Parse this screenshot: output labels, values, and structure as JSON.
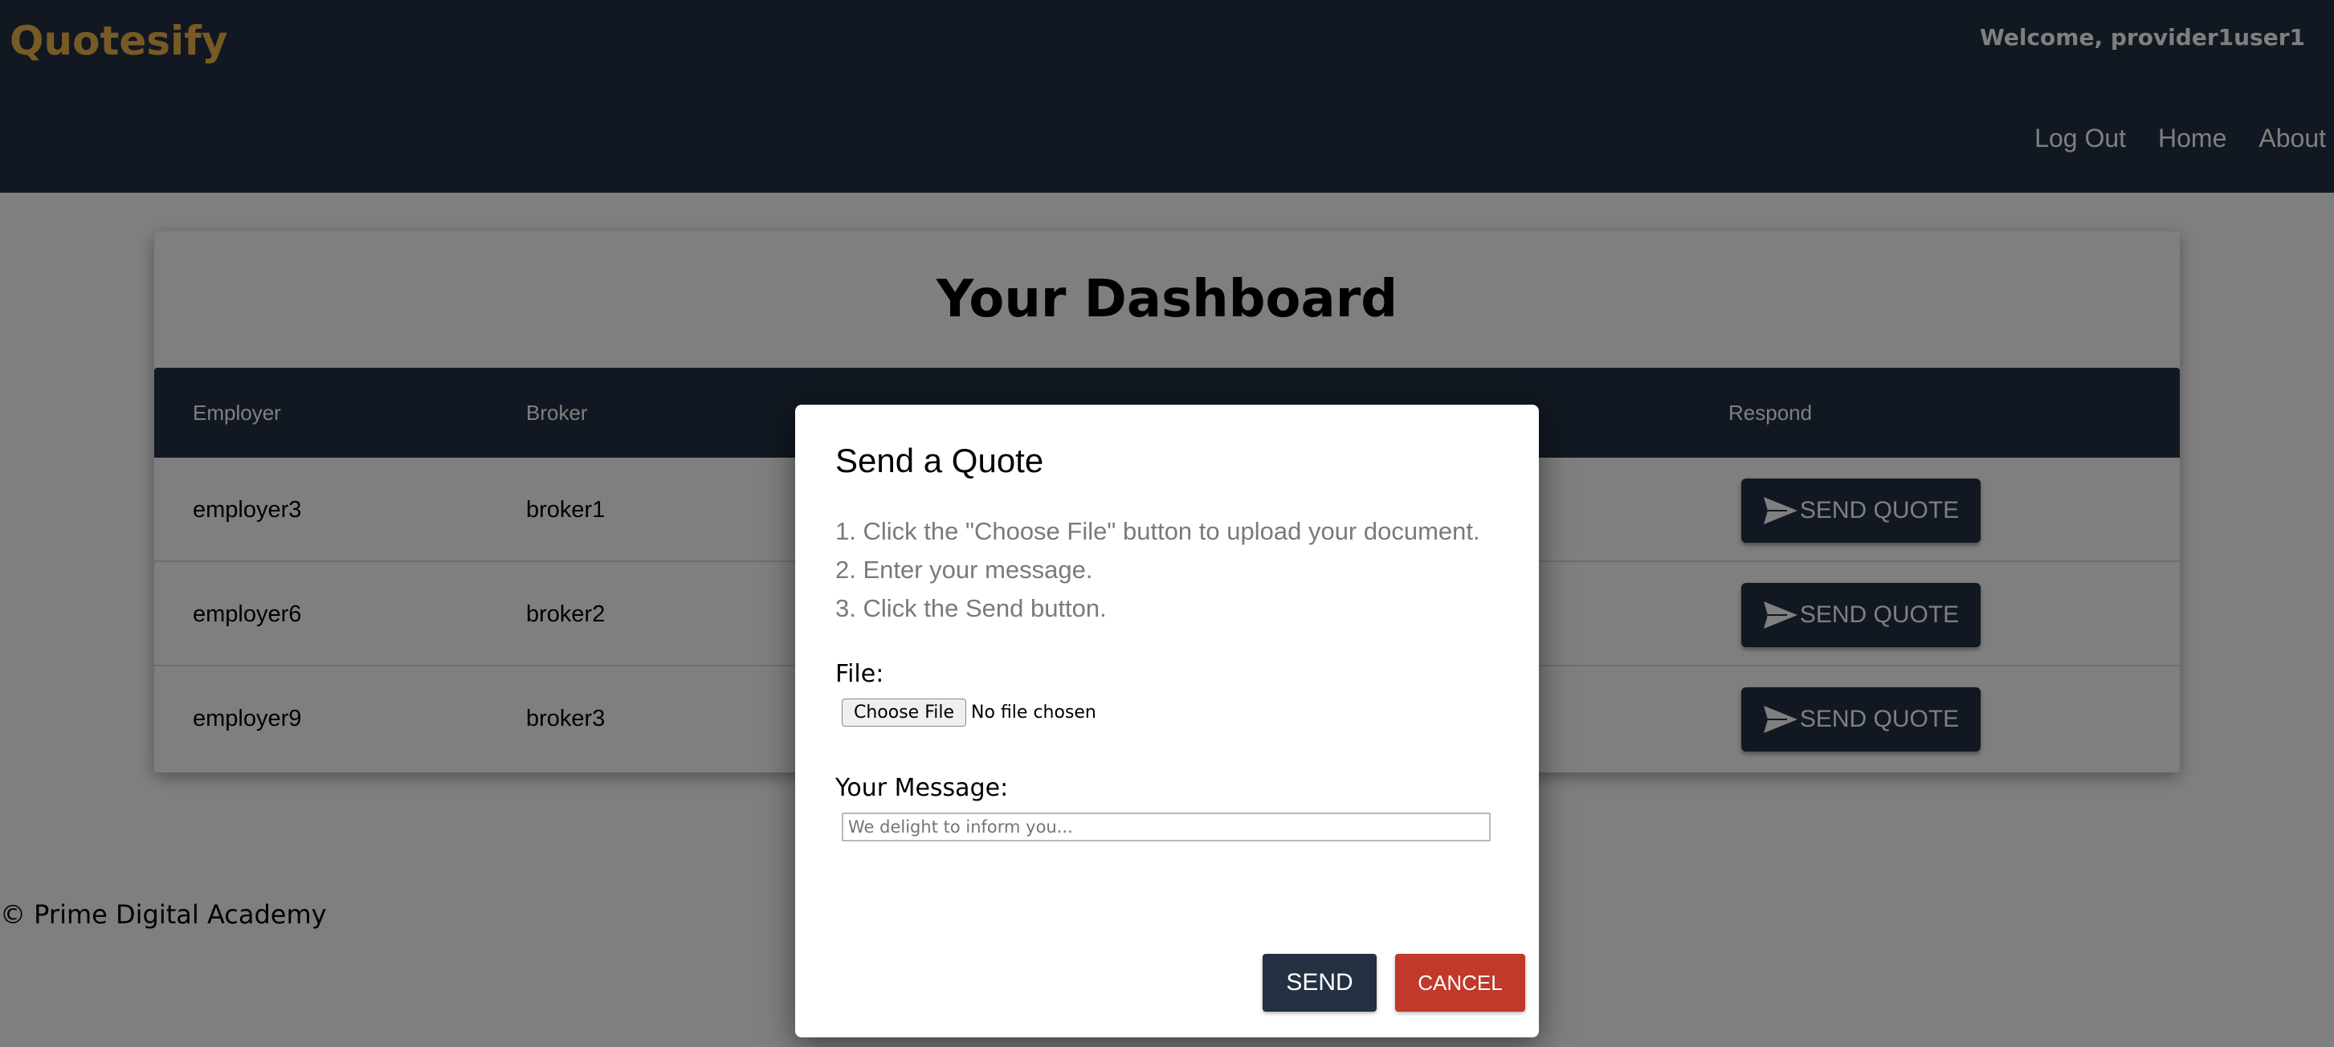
{
  "app": {
    "brand": "Quotesify",
    "welcome": "Welcome, provider1user1"
  },
  "nav": {
    "links": [
      "Log Out",
      "Home",
      "About"
    ]
  },
  "dashboard": {
    "title": "Your Dashboard",
    "headers": {
      "employer": "Employer",
      "broker": "Broker",
      "respond": "Respond"
    },
    "rows": [
      {
        "employer": "employer3",
        "broker": "broker1",
        "action": "SEND QUOTE"
      },
      {
        "employer": "employer6",
        "broker": "broker2",
        "action": "SEND QUOTE"
      },
      {
        "employer": "employer9",
        "broker": "broker3",
        "action": "SEND QUOTE"
      }
    ]
  },
  "footer": {
    "text": "© Prime Digital Academy"
  },
  "modal": {
    "title": "Send a Quote",
    "steps": [
      "1. Click the \"Choose File\" button to upload your document.",
      "2. Enter your message.",
      "3. Click the Send button."
    ],
    "file_label": "File:",
    "choose_file": "Choose File",
    "no_file": "No file chosen",
    "message_label": "Your Message:",
    "message_placeholder": "We delight to inform you...",
    "send": "SEND",
    "cancel": "CANCEL"
  },
  "icons": {
    "send_quote": "paper-plane-icon"
  },
  "colors": {
    "navy": "#233142",
    "brand_gold": "#f0b449",
    "cancel_red": "#c0392b"
  }
}
